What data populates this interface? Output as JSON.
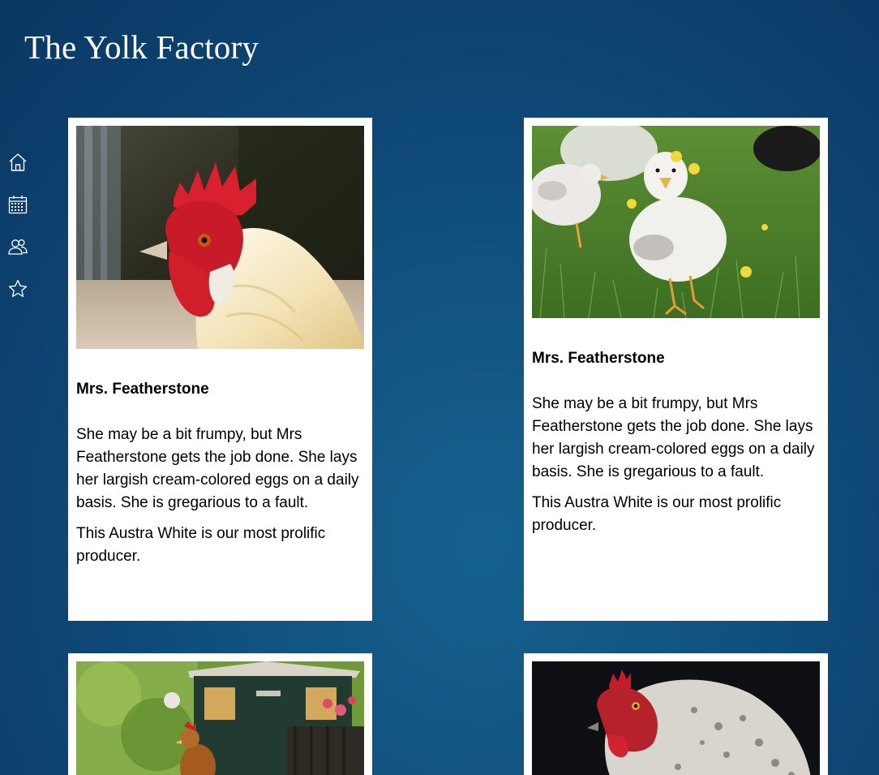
{
  "site": {
    "title": "The Yolk Factory"
  },
  "nav": [
    {
      "id": "home",
      "icon": "home-icon"
    },
    {
      "id": "calendar",
      "icon": "calendar-icon"
    },
    {
      "id": "people",
      "icon": "people-icon"
    },
    {
      "id": "favorites",
      "icon": "star-icon"
    }
  ],
  "cards": [
    {
      "name": "Mrs. Featherstone",
      "description": "She may be a bit frumpy, but Mrs Featherstone gets the job done. She lays her largish cream-colored eggs on a daily basis. She is gregarious to a fault.",
      "note": "This Austra White is our most prolific producer.",
      "photo": "rooster-photo"
    },
    {
      "name": "Mrs. Featherstone",
      "description": "She may be a bit frumpy, but Mrs Featherstone gets the job done. She lays her largish cream-colored eggs on a daily basis. She is gregarious to a fault.",
      "note": "This Austra White is our most prolific producer.",
      "photo": "chick-photo"
    },
    {
      "photo": "garden-hen-photo"
    },
    {
      "photo": "grey-hen-photo"
    }
  ],
  "colors": {
    "background": "#125582",
    "card": "#ffffff",
    "icon": "#ffffff"
  }
}
